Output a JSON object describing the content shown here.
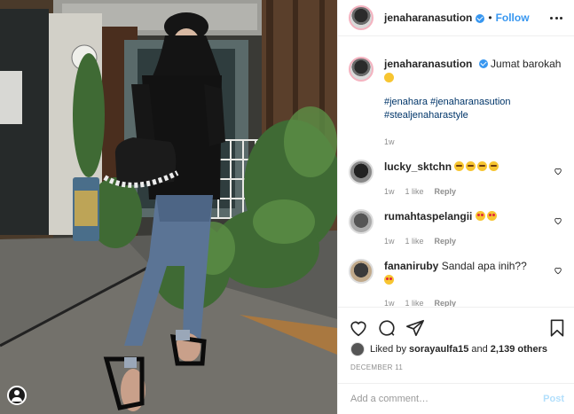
{
  "post": {
    "username": "jenaharanasution",
    "follow_label": "Follow",
    "dot": "•",
    "caption": {
      "username": "jenaharanasution",
      "text": "Jumat barokah",
      "emoji_icon": "bee-emoji-icon",
      "hashtags": "#jenahara #jenaharanasution #stealjenaharastyle",
      "time": "1w"
    },
    "comments": [
      {
        "username": "lucky_sktchn",
        "text": "",
        "emoji": [
          "cry",
          "cry",
          "cry",
          "cry"
        ],
        "time": "1w",
        "likes": "1 like",
        "reply": "Reply"
      },
      {
        "username": "rumahtaspelangii",
        "text": "",
        "emoji": [
          "red",
          "red"
        ],
        "time": "1w",
        "likes": "1 like",
        "reply": "Reply"
      },
      {
        "username": "fananiruby",
        "text": "Sandal apa inih??",
        "emoji": [
          "red"
        ],
        "time": "1w",
        "likes": "1 like",
        "reply": "Reply"
      }
    ],
    "likes": {
      "prefix": "Liked by ",
      "user": "sorayaulfa15",
      "middle": " and ",
      "count": "2,139 others"
    },
    "date": "DECEMBER 11",
    "add_comment_placeholder": "Add a comment…",
    "post_button": "Post"
  },
  "colors": {
    "accent": "#3897f0",
    "hashtag": "#003569",
    "muted": "#8e8e8e",
    "post_disabled": "#b2dffc"
  }
}
